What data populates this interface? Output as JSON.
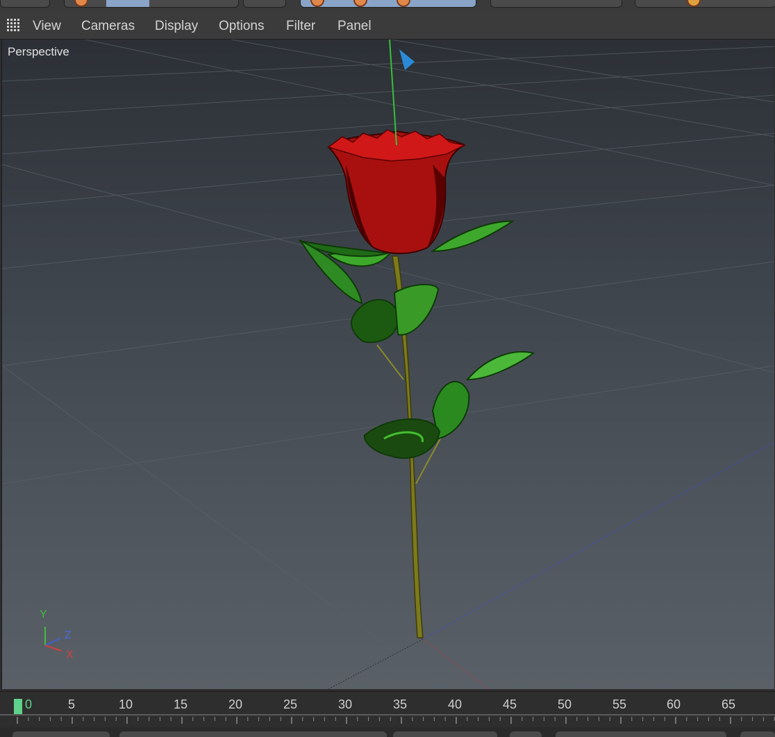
{
  "menubar": {
    "items": [
      "View",
      "Cameras",
      "Display",
      "Options",
      "Filter",
      "Panel"
    ]
  },
  "viewport": {
    "label": "Perspective",
    "axes": {
      "y": "Y",
      "z": "Z",
      "x": "X"
    }
  },
  "timeline": {
    "current_frame": "0",
    "ticks": [
      "5",
      "10",
      "15",
      "20",
      "25",
      "30",
      "35",
      "40",
      "45",
      "50",
      "55",
      "60",
      "65"
    ]
  },
  "colors": {
    "accent_frame": "#5fd18a",
    "axis_y": "#3fbf3f",
    "axis_x": "#d04040",
    "axis_z": "#4060d0"
  },
  "icons": [
    "grid-icon",
    "axis-gizmo-icon",
    "move-handle-icon"
  ]
}
